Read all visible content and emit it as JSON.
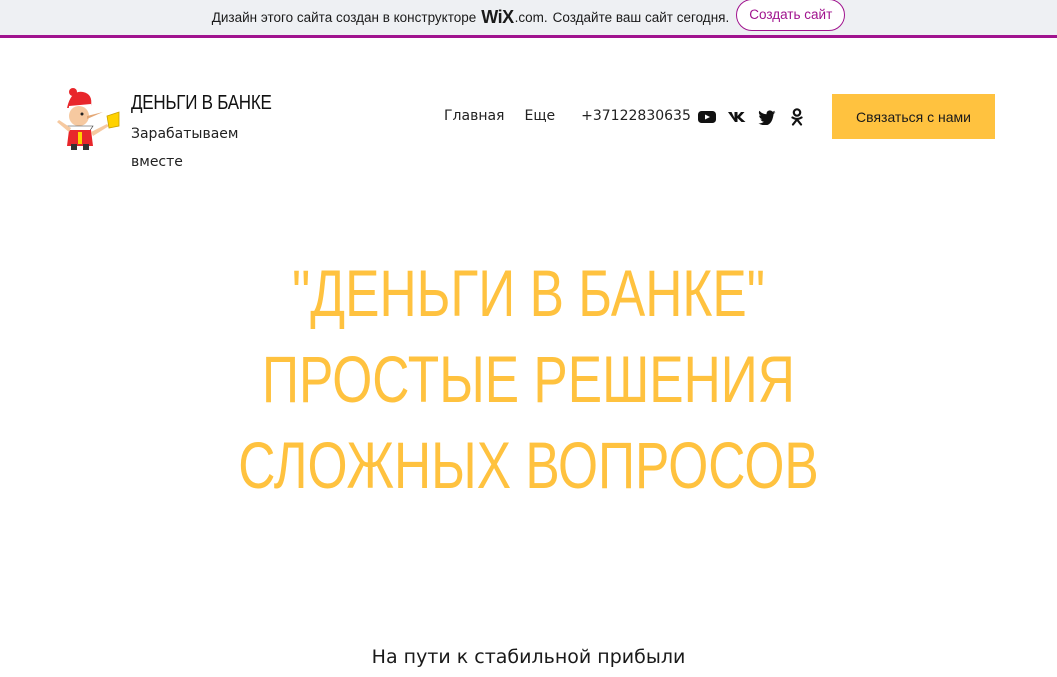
{
  "wix_banner": {
    "text_before": "Дизайн этого сайта создан в конструкторе",
    "logo": "WiX",
    "logo_suffix": ".com.",
    "text_after": "Создайте ваш сайт сегодня.",
    "button_label": "Создать сайт",
    "accent_color": "#a0138e"
  },
  "header": {
    "logo_icon": "pinocchio-logo-icon",
    "title": "ДЕНЬГИ В БАНКЕ",
    "tagline": "Зарабатываем вместе",
    "nav": {
      "home": "Главная",
      "more": "Еще",
      "phone": "+37122830635"
    },
    "socials": [
      "youtube-icon",
      "vk-icon",
      "twitter-icon",
      "odnoklassniki-icon"
    ],
    "contact_button": "Связаться с нами",
    "accent_color": "#ffc23f"
  },
  "hero": {
    "line1": "\"ДЕНЬГИ В БАНКЕ\"",
    "line2": "ПРОСТЫЕ РЕШЕНИЯ",
    "line3": "СЛОЖНЫХ ВОПРОСОВ",
    "color": "#ffc23f"
  },
  "subtitle": "На пути к стабильной прибыли"
}
